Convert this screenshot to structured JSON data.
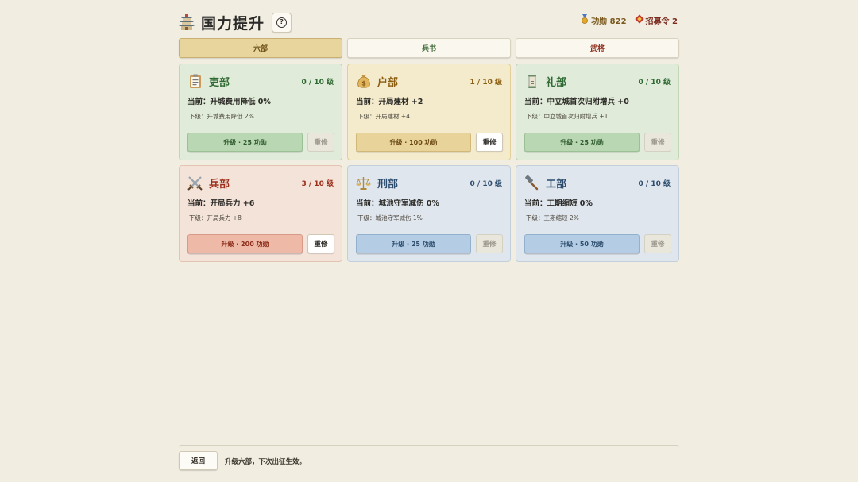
{
  "header": {
    "title": "国力提升",
    "title_icon": "pagoda-icon",
    "help_label": "?",
    "resources": [
      {
        "icon": "medal-icon",
        "text": "功勋 822"
      },
      {
        "icon": "token-icon",
        "text": "招募令 2"
      }
    ]
  },
  "tabs": [
    {
      "label": "六部",
      "active": true
    },
    {
      "label": "兵书",
      "active": false
    },
    {
      "label": "武将",
      "active": false
    }
  ],
  "departments": [
    {
      "name": "吏部",
      "icon": "clipboard-icon",
      "level": "0 / 10 级",
      "current": "当前：升城费用降低 0%",
      "next": "下级：升城费用降低 2%",
      "upgrade": "升级 · 25 功勋",
      "reset": "重修",
      "theme": "green",
      "reset_enabled": false
    },
    {
      "name": "户部",
      "icon": "money-bag-icon",
      "level": "1 / 10 级",
      "current": "当前：开局建材 +2",
      "next": "下级：开局建材 +4",
      "upgrade": "升级 · 100 功勋",
      "reset": "重修",
      "theme": "gold",
      "reset_enabled": true
    },
    {
      "name": "礼部",
      "icon": "scroll-icon",
      "level": "0 / 10 级",
      "current": "当前：中立城首次归附增兵 +0",
      "next": "下级：中立城首次归附增兵 +1",
      "upgrade": "升级 · 25 功勋",
      "reset": "重修",
      "theme": "green",
      "reset_enabled": false
    },
    {
      "name": "兵部",
      "icon": "crossed-swords-icon",
      "level": "3 / 10 级",
      "current": "当前：开局兵力 +6",
      "next": "下级：开局兵力 +8",
      "upgrade": "升级 · 200 功勋",
      "reset": "重修",
      "theme": "red",
      "reset_enabled": true
    },
    {
      "name": "刑部",
      "icon": "scales-icon",
      "level": "0 / 10 级",
      "current": "当前：城池守军减伤 0%",
      "next": "下级：城池守军减伤 1%",
      "upgrade": "升级 · 25 功勋",
      "reset": "重修",
      "theme": "blue",
      "reset_enabled": false
    },
    {
      "name": "工部",
      "icon": "hammer-icon",
      "level": "0 / 10 级",
      "current": "当前：工期缩短 0%",
      "next": "下级：工期缩短 2%",
      "upgrade": "升级 · 50 功勋",
      "reset": "重修",
      "theme": "blue",
      "reset_enabled": false
    }
  ],
  "footer": {
    "back_label": "返回",
    "hint": "升级六部，下次出征生效。"
  }
}
